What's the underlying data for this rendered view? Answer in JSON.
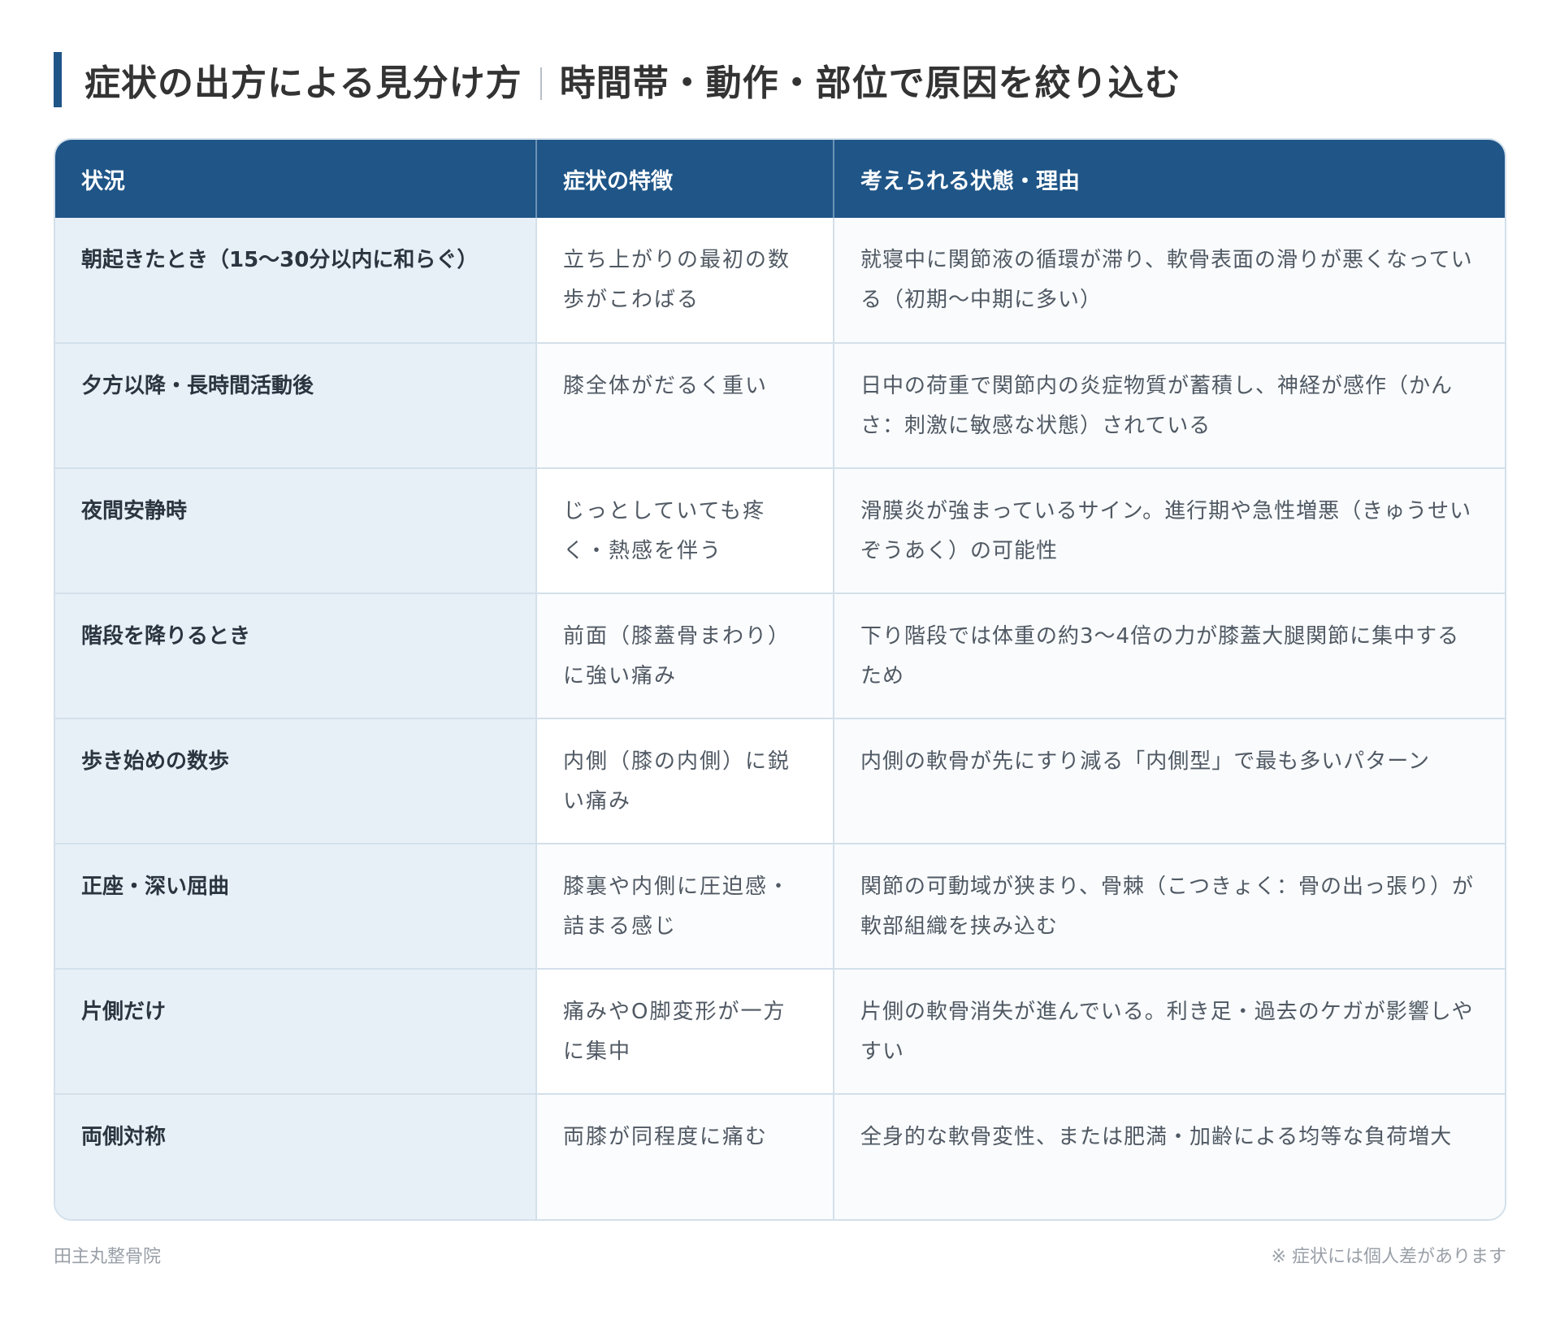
{
  "header": {
    "title_main": "症状の出方による見分け方",
    "title_sub": "時間帯・動作・部位で原因を絞り込む"
  },
  "table": {
    "columns": [
      "状況",
      "症状の特徴",
      "考えられる状態・理由"
    ],
    "rows": [
      {
        "situation": "朝起きたとき（15〜30分以内に和らぐ）",
        "feature": "立ち上がりの最初の数歩がこわばる",
        "reason": "就寝中に関節液の循環が滞り、軟骨表面の滑りが悪くなっている（初期〜中期に多い）"
      },
      {
        "situation": "夕方以降・長時間活動後",
        "feature": "膝全体がだるく重い",
        "reason": "日中の荷重で関節内の炎症物質が蓄積し、神経が感作（かんさ：刺激に敏感な状態）されている"
      },
      {
        "situation": "夜間安静時",
        "feature": "じっとしていても疼く・熱感を伴う",
        "reason": "滑膜炎が強まっているサイン。進行期や急性増悪（きゅうせいぞうあく）の可能性"
      },
      {
        "situation": "階段を降りるとき",
        "feature": "前面（膝蓋骨まわり）に強い痛み",
        "reason": "下り階段では体重の約3〜4倍の力が膝蓋大腿関節に集中するため"
      },
      {
        "situation": "歩き始めの数歩",
        "feature": "内側（膝の内側）に鋭い痛み",
        "reason": "内側の軟骨が先にすり減る「内側型」で最も多いパターン"
      },
      {
        "situation": "正座・深い屈曲",
        "feature": "膝裏や内側に圧迫感・詰まる感じ",
        "reason": "関節の可動域が狭まり、骨棘（こつきょく：骨の出っ張り）が軟部組織を挟み込む"
      },
      {
        "situation": "片側だけ",
        "feature": "痛みやO脚変形が一方に集中",
        "reason": "片側の軟骨消失が進んでいる。利き足・過去のケガが影響しやすい"
      },
      {
        "situation": "両側対称",
        "feature": "両膝が同程度に痛む",
        "reason": "全身的な軟骨変性、または肥満・加齢による均等な負荷増大"
      }
    ]
  },
  "footer": {
    "left": "田主丸整骨院",
    "right": "※ 症状には個人差があります"
  },
  "colors": {
    "accent": "#1f5587",
    "situation_bg": "#e8f0f7",
    "border": "#d3e0ea"
  }
}
